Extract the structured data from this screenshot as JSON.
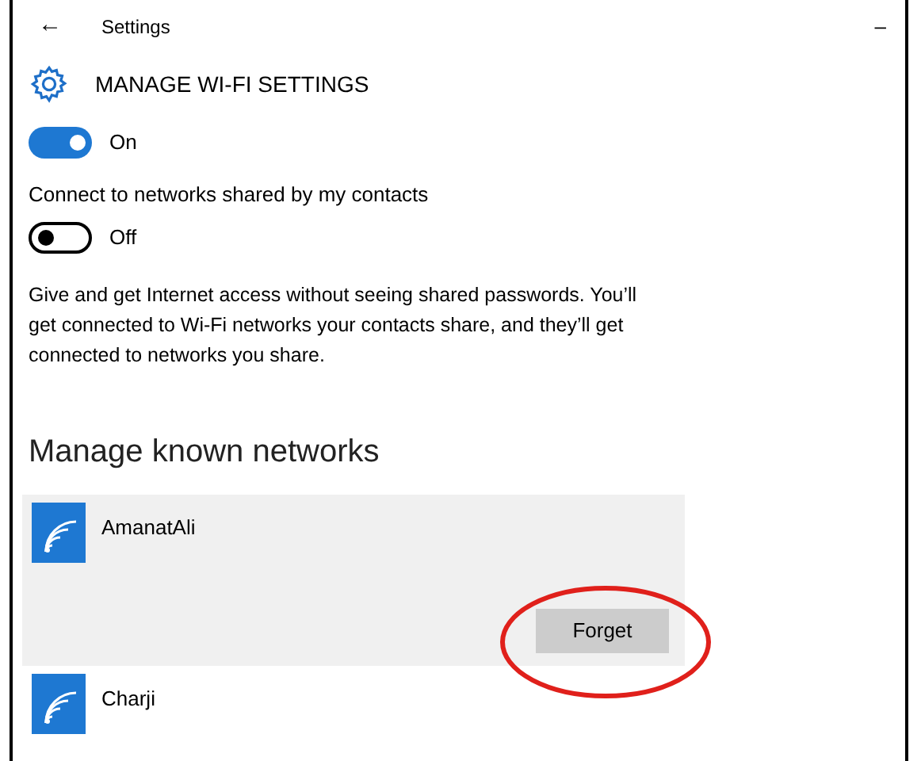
{
  "window": {
    "back": "←",
    "title": "Settings",
    "minimize": "–"
  },
  "header": {
    "title": "MANAGE WI-FI SETTINGS"
  },
  "toggles": [
    {
      "on": true,
      "state_text": "On"
    },
    {
      "label": "Connect to networks shared by my contacts",
      "on": false,
      "state_text": "Off"
    }
  ],
  "description": "Give and get Internet access without seeing shared passwords. You’ll get connected to Wi-Fi networks your contacts share, and they’ll get connected to networks you share.",
  "known_networks": {
    "heading": "Manage known networks",
    "items": [
      {
        "name": "AmanatAli",
        "selected": true,
        "button": "Forget"
      },
      {
        "name": "Charji",
        "selected": false
      }
    ]
  },
  "annotation": {
    "kind": "ellipse",
    "color": "#e0201b"
  }
}
